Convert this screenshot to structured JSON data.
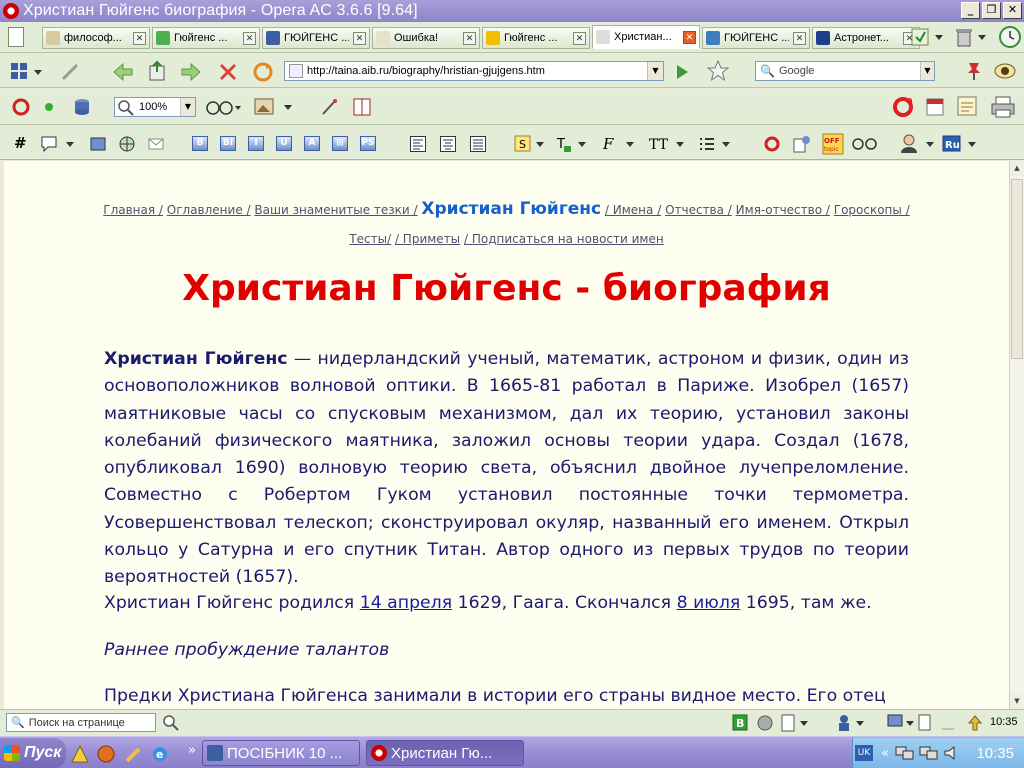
{
  "window": {
    "title": "Христиан Гюйгенс биография - Opera AC 3.6.6 [9.64]",
    "minimize": "_",
    "maximize": "❐",
    "close": "✕"
  },
  "tabs": [
    {
      "label": "философ...",
      "fav_color": "#d9c9a0",
      "active": false
    },
    {
      "label": "Гюйгенс ...",
      "fav_color": "#4caf50",
      "active": false
    },
    {
      "label": "ГЮЙГЕНС ...",
      "fav_color": "#3b5fa0",
      "active": false
    },
    {
      "label": "Ошибка!",
      "fav_color": "#e8e0c8",
      "active": false
    },
    {
      "label": "Гюйгенс ...",
      "fav_color": "#f0c000",
      "active": false
    },
    {
      "label": "Христиан...",
      "fav_color": "#dddddd",
      "active": true
    },
    {
      "label": "ГЮЙГЕНС ...",
      "fav_color": "#3b7fc0",
      "active": false
    },
    {
      "label": "Астронет...",
      "fav_color": "#1a3f8f",
      "active": false
    }
  ],
  "address": {
    "url": "http://taina.aib.ru/biography/hristian-gjujgens.htm"
  },
  "search": {
    "placeholder": "Google"
  },
  "zoom": {
    "value": "100%"
  },
  "format_buttons": [
    "B",
    "BI",
    "I",
    "U",
    "A",
    "⊞",
    "PS"
  ],
  "breadcrumbs": {
    "items": [
      "Главная /",
      "Оглавление /",
      "Ваши знаменитые тезки /"
    ],
    "current": "Христиан Гюйгенс",
    "after": [
      "/ Имена /",
      "Отчества /",
      "Имя-отчество /",
      "Гороскопы /"
    ],
    "line2": [
      "Тесты/",
      "/ Приметы",
      "/ Подписаться на новости имен"
    ]
  },
  "page": {
    "heading": "Христиан Гюйгенс - биография",
    "p1_bold": "Христиан Гюйгенс",
    "p1_rest": " — нидерландский ученый, математик, астроном и физик, один из основоположников волновой оптики.  В 1665-81 работал в Париже. Изобрел (1657) маятниковые часы со спусковым механизмом, дал их теорию, установил законы колебаний физического маятника, заложил основы теории удара. Создал (1678, опубликовал 1690) волновую теорию света, объяснил двойное лучепреломление. Совместно с Робертом Гуком установил постоянные точки термометра. Усовершенствовал телескоп; сконструировал окуляр, названный его именем. Открыл кольцо у Сатурна и его спутник Титан. Автор одного из первых трудов по теории вероятностей (1657).",
    "p2_a": "Христиан Гюйгенс родился ",
    "p2_link1": "14 апреля",
    "p2_b": " 1629, Гаага. Скончался ",
    "p2_link2": "8 июля",
    "p2_c": " 1695, там же.",
    "p3": "Раннее пробуждение талантов",
    "p4": "Предки Христиана Гюйгенса занимали в истории его страны видное место. Его отец"
  },
  "statusbar": {
    "find_placeholder": "Поиск на странице",
    "time": "10:35"
  },
  "taskbar": {
    "start": "Пуск",
    "tasks": [
      {
        "label": "ПОСІБНИК 10 ...",
        "active": false
      },
      {
        "label": "Христиан Гю...",
        "active": true
      }
    ],
    "lang": "UK",
    "clock": "10:35"
  },
  "colors": {
    "heading": "#e00000",
    "body_text": "#1a1a6e",
    "current_crumb": "#1860c8",
    "toolbar_bg": "#e3ecd7",
    "page_bg": "#fefef0"
  }
}
